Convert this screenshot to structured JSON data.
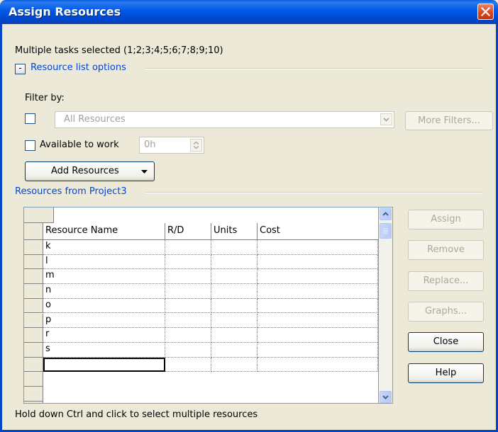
{
  "window": {
    "title": "Assign Resources",
    "close_icon": "close-icon"
  },
  "header": {
    "tasks_selected": "Multiple tasks selected (1;2;3;4;5;6;7;8;9;10)"
  },
  "options": {
    "collapse_glyph": "-",
    "label": "Resource list options"
  },
  "filter": {
    "label": "Filter by:",
    "combo_value": "All Resources",
    "more_filters": "More Filters..."
  },
  "available": {
    "label": "Available to work",
    "value": "0h"
  },
  "add_resources": {
    "label": "Add Resources"
  },
  "resources_section": {
    "label": "Resources from Project3"
  },
  "table": {
    "columns": [
      "Resource Name",
      "R/D",
      "Units",
      "Cost"
    ],
    "rows": [
      "k",
      "l",
      "m",
      "n",
      "o",
      "p",
      "r",
      "s",
      ""
    ]
  },
  "buttons": {
    "assign": "Assign",
    "remove": "Remove",
    "replace": "Replace...",
    "graphs": "Graphs...",
    "close": "Close",
    "help": "Help"
  },
  "footer": {
    "hint": "Hold down Ctrl and click to select multiple resources"
  },
  "colors": {
    "title_blue": "#0058e6",
    "link_blue": "#0046d5",
    "close_red": "#d2441e",
    "grid_line": "#808080"
  }
}
